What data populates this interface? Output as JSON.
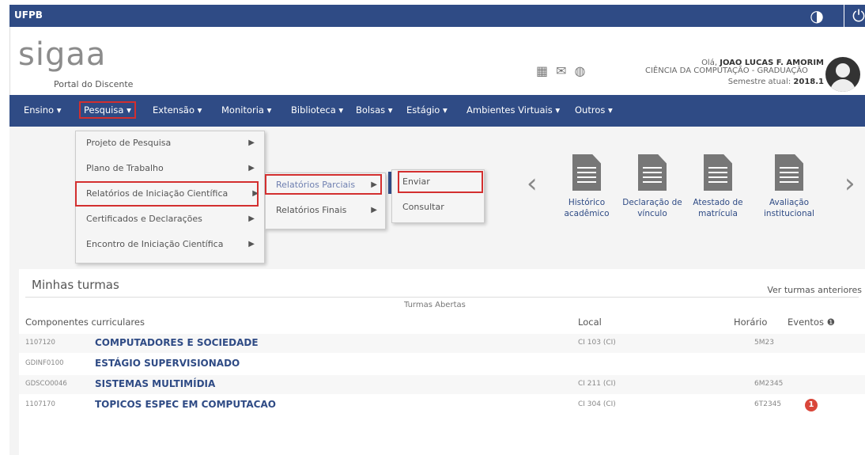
{
  "topbar": {
    "brand": "UFPB",
    "contrast_icon": "◑",
    "power_icon": "⏻"
  },
  "header": {
    "logo": "sigaa",
    "portal": "Portal do Discente",
    "course": "CIÊNCIA DA COMPUTAÇÃO - GRADUAÇÃO",
    "greeting": "Olá,",
    "user": "JOAO LUCAS F. AMORIM",
    "semester_label": "Semestre atual:",
    "semester": "2018.1"
  },
  "nav": [
    "Ensino ▾",
    "Pesquisa ▾",
    "Extensão ▾",
    "Monitoria ▾",
    "Biblioteca ▾",
    "Bolsas ▾",
    "Estágio ▾",
    "Ambientes Virtuais ▾",
    "Outros ▾"
  ],
  "menu1": {
    "items": [
      "Projeto de Pesquisa",
      "Plano de Trabalho",
      "Relatórios de Iniciação Científica",
      "Certificados e Declarações",
      "Encontro de Iniciação Científica"
    ]
  },
  "menu2": {
    "items": [
      "Relatórios Parciais",
      "Relatórios Finais"
    ]
  },
  "menu3": {
    "items": [
      "Enviar",
      "Consultar"
    ]
  },
  "quick": [
    {
      "l1": "Histórico",
      "l2": "acadêmico"
    },
    {
      "l1": "Declaração de",
      "l2": "vínculo"
    },
    {
      "l1": "Atestado de",
      "l2": "matrícula"
    },
    {
      "l1": "Avaliação",
      "l2": "institucional"
    }
  ],
  "turmas": {
    "title": "Minhas turmas",
    "ver": "Ver turmas anteriores",
    "sub": "Turmas Abertas",
    "cols": {
      "comp": "Componentes curriculares",
      "local": "Local",
      "horario": "Horário",
      "eventos": "Eventos ❶"
    },
    "rows": [
      {
        "code": "1107120",
        "name": "COMPUTADORES E SOCIEDADE",
        "local": "CI 103 (CI)",
        "hor": "5M23",
        "badge": ""
      },
      {
        "code": "GDINF0100",
        "name": "ESTÁGIO SUPERVISIONADO",
        "local": "",
        "hor": "",
        "badge": ""
      },
      {
        "code": "GDSCO0046",
        "name": "SISTEMAS MULTIMÍDIA",
        "local": "CI 211 (CI)",
        "hor": "6M2345",
        "badge": ""
      },
      {
        "code": "1107170",
        "name": "TOPICOS ESPEC EM COMPUTACAO",
        "local": "CI 304 (CI)",
        "hor": "6T2345",
        "badge": "1"
      }
    ]
  }
}
